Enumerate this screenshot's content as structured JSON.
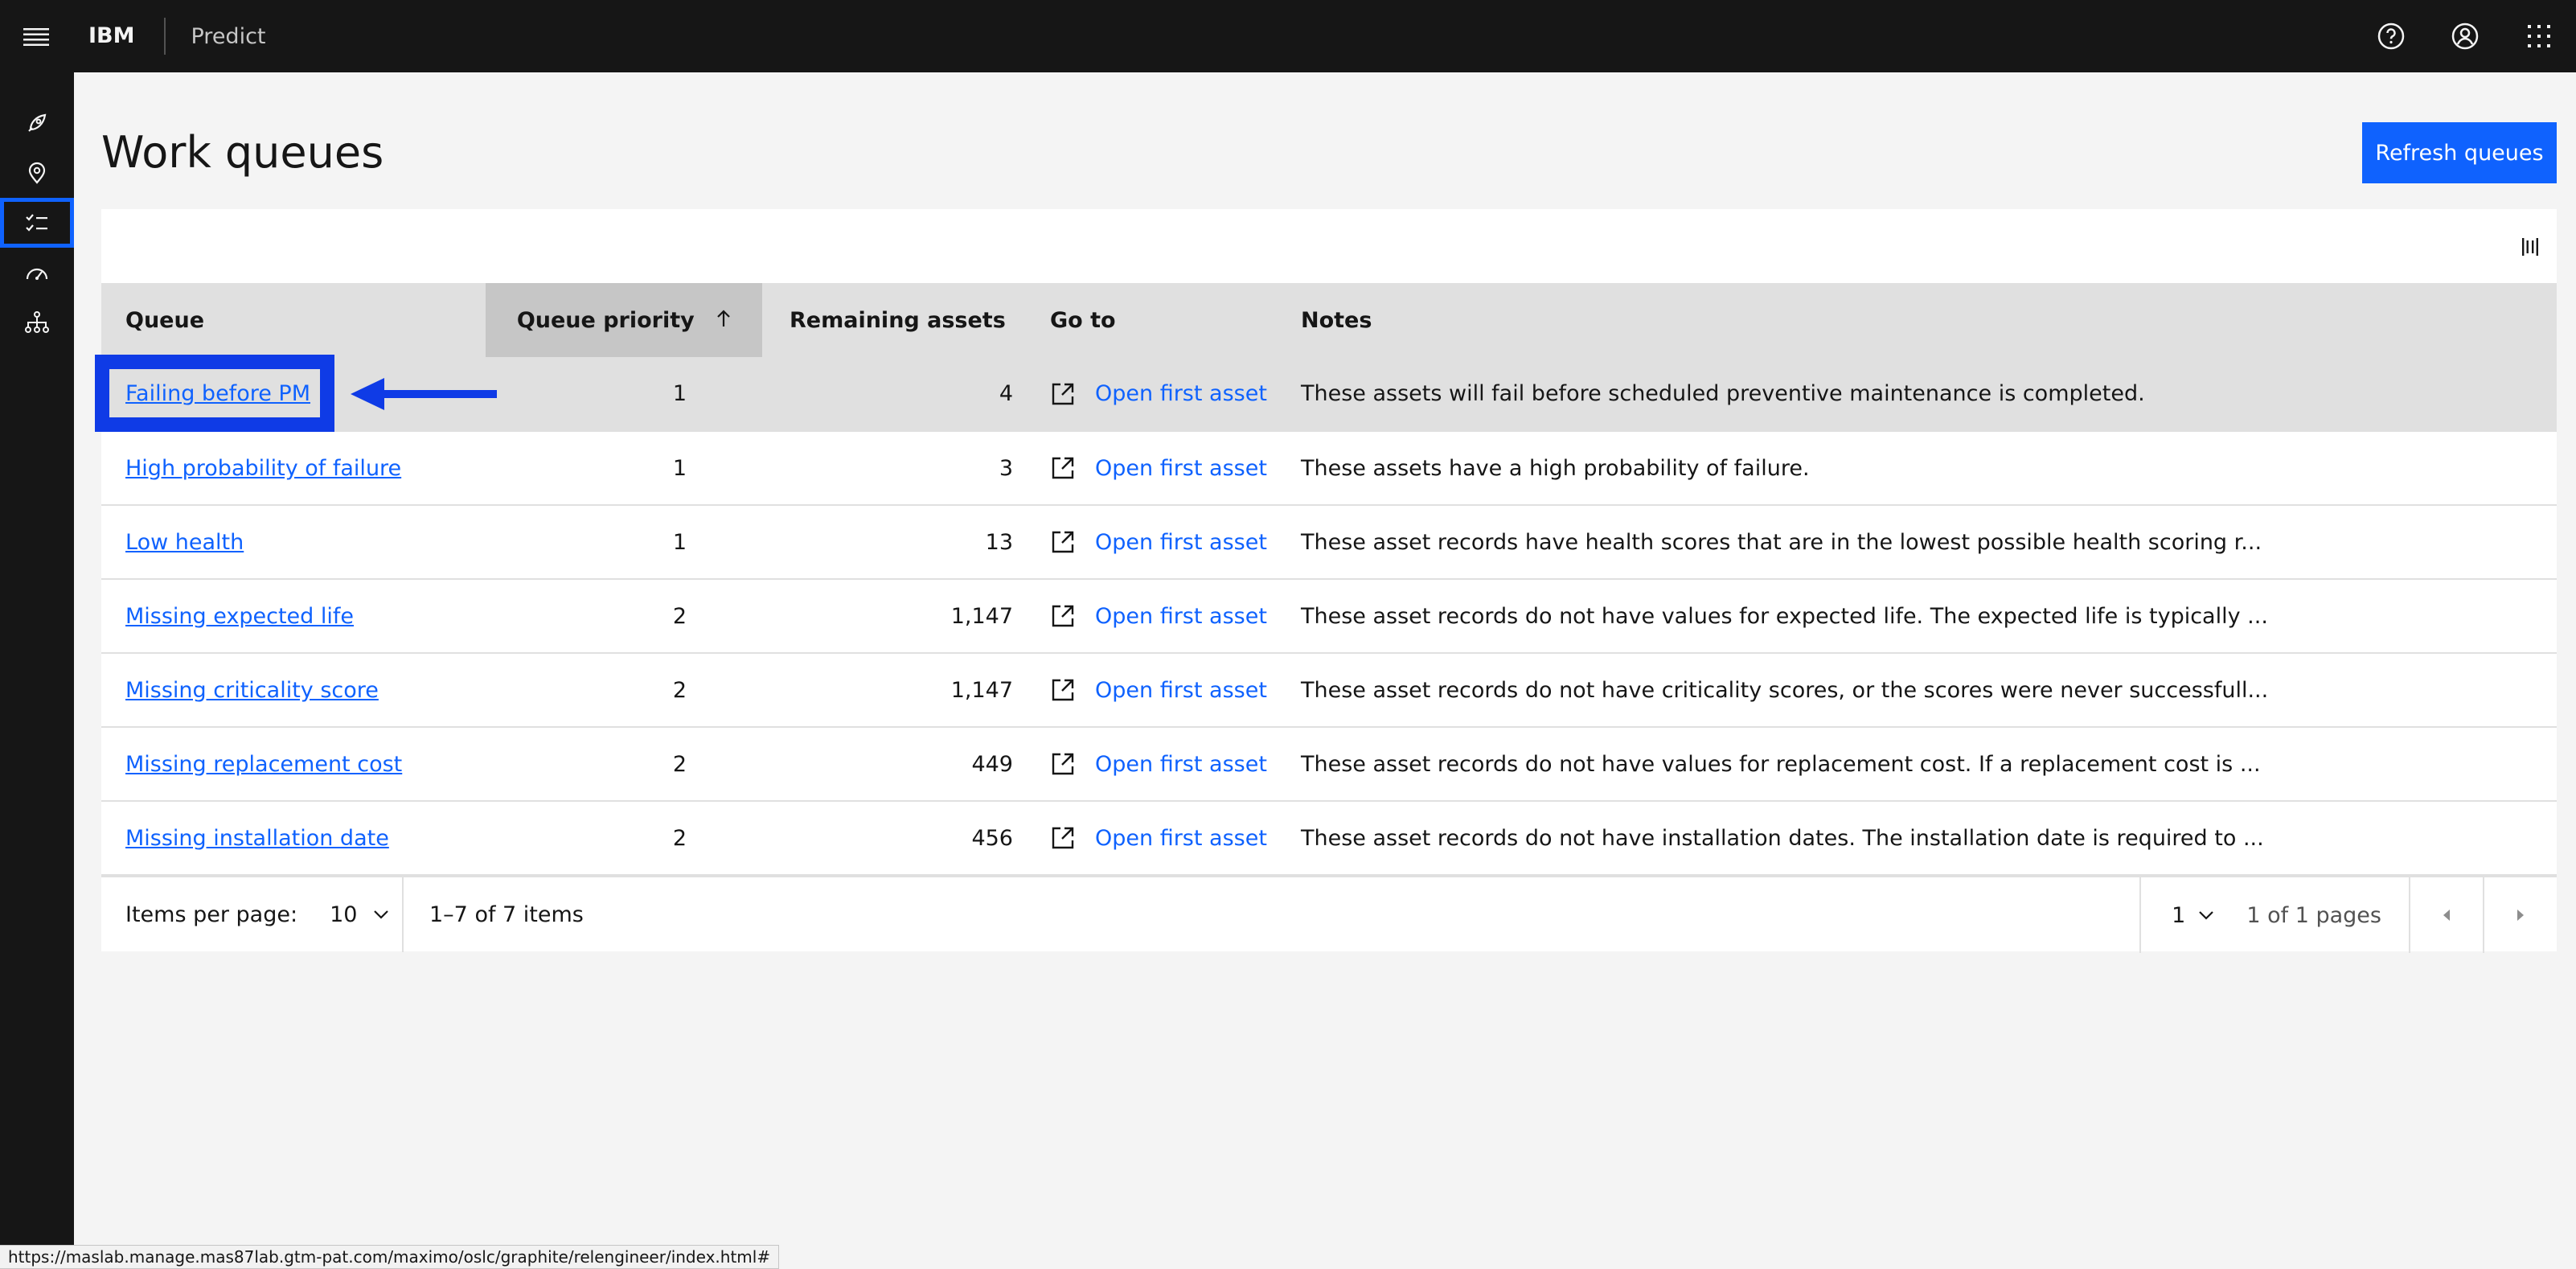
{
  "header": {
    "brand": "IBM",
    "product": "Predict"
  },
  "page": {
    "title": "Work queues",
    "refresh_label": "Refresh queues"
  },
  "table": {
    "columns": [
      "Queue",
      "Queue priority",
      "Remaining assets",
      "Go to",
      "Notes"
    ],
    "rows": [
      {
        "queue": "Failing before PM",
        "priority": "1",
        "remaining": "4",
        "goto": "Open first asset",
        "notes": "These assets will fail before scheduled preventive maintenance is completed."
      },
      {
        "queue": "High probability of failure",
        "priority": "1",
        "remaining": "3",
        "goto": "Open first asset",
        "notes": "These assets have a high probability of failure."
      },
      {
        "queue": "Low health",
        "priority": "1",
        "remaining": "13",
        "goto": "Open first asset",
        "notes": "These asset records have health scores that are in the lowest possible health scoring r..."
      },
      {
        "queue": "Missing expected life",
        "priority": "2",
        "remaining": "1,147",
        "goto": "Open first asset",
        "notes": "These asset records do not have values for expected life. The expected life is typically ..."
      },
      {
        "queue": "Missing criticality score",
        "priority": "2",
        "remaining": "1,147",
        "goto": "Open first asset",
        "notes": "These asset records do not have criticality scores, or the scores were never successfull..."
      },
      {
        "queue": "Missing replacement cost",
        "priority": "2",
        "remaining": "449",
        "goto": "Open first asset",
        "notes": "These asset records do not have values for replacement cost. If a replacement cost is ..."
      },
      {
        "queue": "Missing installation date",
        "priority": "2",
        "remaining": "456",
        "goto": "Open first asset",
        "notes": "These asset records do not have installation dates. The installation date is required to ..."
      }
    ]
  },
  "pagination": {
    "items_per_page_label": "Items per page:",
    "items_per_page_value": "10",
    "range_text": "1–7 of 7 items",
    "page_value": "1",
    "page_total_text": "1 of 1 pages"
  },
  "status_url": "https://maslab.manage.mas87lab.gtm-pat.com/maximo/oslc/graphite/relengineer/index.html#",
  "colors": {
    "accent": "#0f62fe",
    "callout": "#0f3be6",
    "header_bg": "#161616"
  }
}
